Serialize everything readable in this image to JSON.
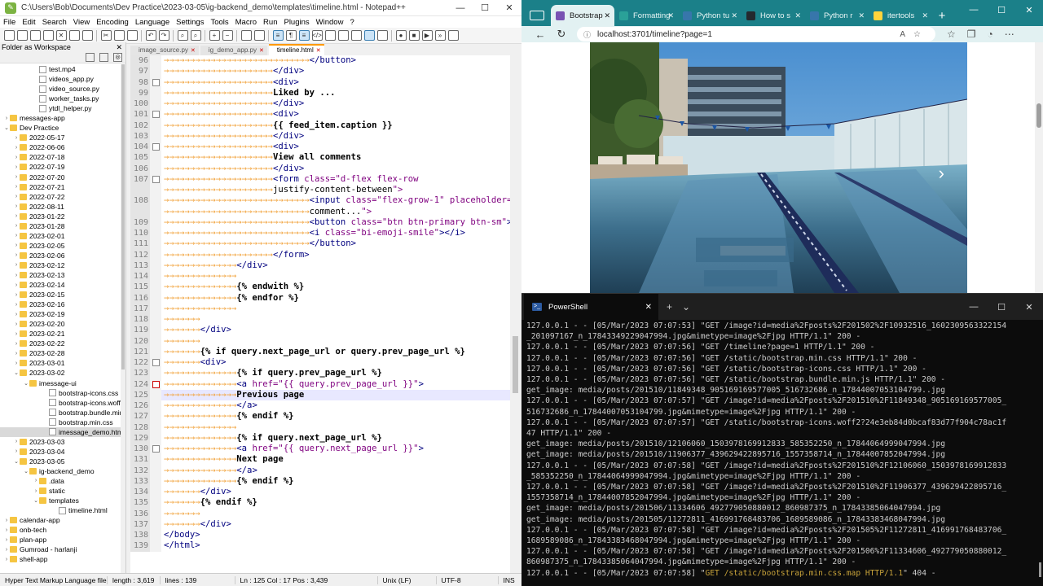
{
  "npp": {
    "title": "C:\\Users\\Bob\\Documents\\Dev Practice\\2023-03-05\\ig-backend_demo\\templates\\timeline.html - Notepad++",
    "menu": [
      "File",
      "Edit",
      "Search",
      "View",
      "Encoding",
      "Language",
      "Settings",
      "Tools",
      "Macro",
      "Run",
      "Plugins",
      "Window",
      "?"
    ],
    "panel_title": "Folder as Workspace",
    "tree": [
      {
        "label": "test.mp4",
        "indent": 3,
        "kind": "file"
      },
      {
        "label": "videos_app.py",
        "indent": 3,
        "kind": "file"
      },
      {
        "label": "video_source.py",
        "indent": 3,
        "kind": "file"
      },
      {
        "label": "worker_tasks.py",
        "indent": 3,
        "kind": "file"
      },
      {
        "label": "ytdl_helper.py",
        "indent": 3,
        "kind": "file"
      },
      {
        "label": "messages-app",
        "indent": 0,
        "kind": "folder",
        "exp": "›"
      },
      {
        "label": "Dev Practice",
        "indent": 0,
        "kind": "folder",
        "exp": "⌄"
      },
      {
        "label": "2022-05-17",
        "indent": 1,
        "kind": "folder",
        "exp": "›"
      },
      {
        "label": "2022-06-06",
        "indent": 1,
        "kind": "folder",
        "exp": "›"
      },
      {
        "label": "2022-07-18",
        "indent": 1,
        "kind": "folder",
        "exp": "›"
      },
      {
        "label": "2022-07-19",
        "indent": 1,
        "kind": "folder",
        "exp": "›"
      },
      {
        "label": "2022-07-20",
        "indent": 1,
        "kind": "folder",
        "exp": "›"
      },
      {
        "label": "2022-07-21",
        "indent": 1,
        "kind": "folder",
        "exp": "›"
      },
      {
        "label": "2022-07-22",
        "indent": 1,
        "kind": "folder",
        "exp": "›"
      },
      {
        "label": "2022-08-11",
        "indent": 1,
        "kind": "folder",
        "exp": "›"
      },
      {
        "label": "2023-01-22",
        "indent": 1,
        "kind": "folder",
        "exp": "›"
      },
      {
        "label": "2023-01-28",
        "indent": 1,
        "kind": "folder",
        "exp": "›"
      },
      {
        "label": "2023-02-01",
        "indent": 1,
        "kind": "folder",
        "exp": "›"
      },
      {
        "label": "2023-02-05",
        "indent": 1,
        "kind": "folder",
        "exp": "›"
      },
      {
        "label": "2023-02-06",
        "indent": 1,
        "kind": "folder",
        "exp": "›"
      },
      {
        "label": "2023-02-12",
        "indent": 1,
        "kind": "folder",
        "exp": "›"
      },
      {
        "label": "2023-02-13",
        "indent": 1,
        "kind": "folder",
        "exp": "›"
      },
      {
        "label": "2023-02-14",
        "indent": 1,
        "kind": "folder",
        "exp": "›"
      },
      {
        "label": "2023-02-15",
        "indent": 1,
        "kind": "folder",
        "exp": "›"
      },
      {
        "label": "2023-02-16",
        "indent": 1,
        "kind": "folder",
        "exp": "›"
      },
      {
        "label": "2023-02-19",
        "indent": 1,
        "kind": "folder",
        "exp": "›"
      },
      {
        "label": "2023-02-20",
        "indent": 1,
        "kind": "folder",
        "exp": "›"
      },
      {
        "label": "2023-02-21",
        "indent": 1,
        "kind": "folder",
        "exp": "›"
      },
      {
        "label": "2023-02-22",
        "indent": 1,
        "kind": "folder",
        "exp": "›"
      },
      {
        "label": "2023-02-28",
        "indent": 1,
        "kind": "folder",
        "exp": "›"
      },
      {
        "label": "2023-03-01",
        "indent": 1,
        "kind": "folder",
        "exp": "›"
      },
      {
        "label": "2023-03-02",
        "indent": 1,
        "kind": "folder",
        "exp": "⌄"
      },
      {
        "label": "imessage-ui",
        "indent": 2,
        "kind": "folder",
        "exp": "⌄"
      },
      {
        "label": "bootstrap-icons.css",
        "indent": 4,
        "kind": "file"
      },
      {
        "label": "bootstrap-icons.woff2",
        "indent": 4,
        "kind": "file"
      },
      {
        "label": "bootstrap.bundle.min.js",
        "indent": 4,
        "kind": "file"
      },
      {
        "label": "bootstrap.min.css",
        "indent": 4,
        "kind": "file"
      },
      {
        "label": "imessage_demo.html",
        "indent": 4,
        "kind": "file",
        "sel": true
      },
      {
        "label": "2023-03-03",
        "indent": 1,
        "kind": "folder",
        "exp": "›"
      },
      {
        "label": "2023-03-04",
        "indent": 1,
        "kind": "folder",
        "exp": "›"
      },
      {
        "label": "2023-03-05",
        "indent": 1,
        "kind": "folder",
        "exp": "⌄"
      },
      {
        "label": "ig-backend_demo",
        "indent": 2,
        "kind": "folder",
        "exp": "⌄"
      },
      {
        "label": ".data",
        "indent": 3,
        "kind": "folder",
        "exp": "›"
      },
      {
        "label": "static",
        "indent": 3,
        "kind": "folder",
        "exp": "›"
      },
      {
        "label": "templates",
        "indent": 3,
        "kind": "folder",
        "exp": "⌄"
      },
      {
        "label": "timeline.html",
        "indent": 5,
        "kind": "file"
      },
      {
        "label": "calendar-app",
        "indent": 0,
        "kind": "folder",
        "exp": "›"
      },
      {
        "label": "onb-tech",
        "indent": 0,
        "kind": "folder",
        "exp": "›"
      },
      {
        "label": "plan-app",
        "indent": 0,
        "kind": "folder",
        "exp": "›"
      },
      {
        "label": "Gumroad - harlanji",
        "indent": 0,
        "kind": "folder",
        "exp": "›"
      },
      {
        "label": "shell-app",
        "indent": 0,
        "kind": "folder",
        "exp": "›"
      }
    ],
    "tabs": [
      {
        "label": "image_source.py",
        "active": false
      },
      {
        "label": "ig_demo_app.py",
        "active": false
      },
      {
        "label": "timeline.html",
        "active": true
      }
    ],
    "lines": [
      {
        "n": "96",
        "d": 4,
        "c": "</button>",
        "f": ""
      },
      {
        "n": "97",
        "d": 3,
        "c": "</div>",
        "f": ""
      },
      {
        "n": "98",
        "d": 3,
        "c": "<div>",
        "f": "box"
      },
      {
        "n": "99",
        "d": 3,
        "c": "Liked by ...",
        "f": "",
        "txt": true
      },
      {
        "n": "100",
        "d": 3,
        "c": "</div>",
        "f": ""
      },
      {
        "n": "101",
        "d": 3,
        "c": "<div>",
        "f": "box"
      },
      {
        "n": "102",
        "d": 3,
        "c": "{{ feed_item.caption }}",
        "f": "",
        "txt": true
      },
      {
        "n": "103",
        "d": 3,
        "c": "</div>",
        "f": ""
      },
      {
        "n": "104",
        "d": 3,
        "c": "<div>",
        "f": "box"
      },
      {
        "n": "105",
        "d": 3,
        "c": "View all comments",
        "f": "",
        "txt": true
      },
      {
        "n": "106",
        "d": 3,
        "c": "</div>",
        "f": ""
      },
      {
        "n": "107",
        "d": 3,
        "c": "<form class=\"d-flex flex-row",
        "f": "box"
      },
      {
        "n": "",
        "d": 3,
        "c": "justify-content-between\">",
        "f": ""
      },
      {
        "n": "108",
        "d": 4,
        "c": "<input class=\"flex-grow-1\" placeholder=\"Add a",
        "f": ""
      },
      {
        "n": "",
        "d": 4,
        "c": "comment...\">",
        "f": ""
      },
      {
        "n": "109",
        "d": 4,
        "c": "<button class=\"btn btn-primary btn-sm\">",
        "f": ""
      },
      {
        "n": "110",
        "d": 4,
        "c": "<i class=\"bi-emoji-smile\"></i>",
        "f": ""
      },
      {
        "n": "111",
        "d": 4,
        "c": "</button>",
        "f": ""
      },
      {
        "n": "112",
        "d": 3,
        "c": "</form>",
        "f": ""
      },
      {
        "n": "113",
        "d": 2,
        "c": "</div>",
        "f": ""
      },
      {
        "n": "114",
        "d": 2,
        "c": "",
        "f": ""
      },
      {
        "n": "115",
        "d": 2,
        "c": "{% endwith %}",
        "f": "",
        "txt": true
      },
      {
        "n": "116",
        "d": 2,
        "c": "{% endfor %}",
        "f": "",
        "txt": true
      },
      {
        "n": "117",
        "d": 2,
        "c": "",
        "f": ""
      },
      {
        "n": "118",
        "d": 1,
        "c": "",
        "f": ""
      },
      {
        "n": "119",
        "d": 1,
        "c": "</div>",
        "f": ""
      },
      {
        "n": "120",
        "d": 1,
        "c": "",
        "f": ""
      },
      {
        "n": "121",
        "d": 1,
        "c": "{% if query.next_page_url or query.prev_page_url %}",
        "f": "",
        "txt": true
      },
      {
        "n": "122",
        "d": 1,
        "c": "<div>",
        "f": "box"
      },
      {
        "n": "123",
        "d": 2,
        "c": "{% if query.prev_page_url %}",
        "f": "",
        "txt": true
      },
      {
        "n": "124",
        "d": 2,
        "c": "<a href=\"{{ query.prev_page_url }}\">",
        "f": "boxred"
      },
      {
        "n": "125",
        "d": 2,
        "c": "Previous page",
        "f": "",
        "txt": true,
        "cur": true
      },
      {
        "n": "126",
        "d": 2,
        "c": "</a>",
        "f": ""
      },
      {
        "n": "127",
        "d": 2,
        "c": "{% endif %}",
        "f": "",
        "txt": true
      },
      {
        "n": "128",
        "d": 2,
        "c": "",
        "f": ""
      },
      {
        "n": "129",
        "d": 2,
        "c": "{% if query.next_page_url %}",
        "f": "",
        "txt": true
      },
      {
        "n": "130",
        "d": 2,
        "c": "<a href=\"{{ query.next_page_url }}\">",
        "f": "box"
      },
      {
        "n": "131",
        "d": 2,
        "c": "Next page",
        "f": "",
        "txt": true
      },
      {
        "n": "132",
        "d": 2,
        "c": "</a>",
        "f": ""
      },
      {
        "n": "133",
        "d": 2,
        "c": "{% endif %}",
        "f": "",
        "txt": true
      },
      {
        "n": "134",
        "d": 1,
        "c": "</div>",
        "f": ""
      },
      {
        "n": "135",
        "d": 1,
        "c": "{% endif %}",
        "f": "",
        "txt": true
      },
      {
        "n": "136",
        "d": 1,
        "c": "",
        "f": ""
      },
      {
        "n": "137",
        "d": 1,
        "c": "</div>",
        "f": ""
      },
      {
        "n": "138",
        "d": 0,
        "c": "</body>",
        "f": ""
      },
      {
        "n": "139",
        "d": 0,
        "c": "</html>",
        "f": ""
      }
    ],
    "status": {
      "lang": "Hyper Text Markup Language file",
      "length": "length : 3,619",
      "lines": "lines : 139",
      "pos": "Ln : 125    Col : 17    Pos : 3,439",
      "eol": "Unix (LF)",
      "enc": "UTF-8",
      "ins": "INS"
    }
  },
  "edge": {
    "tabs": [
      {
        "label": "Bootstrap",
        "active": true,
        "color": "#7952b3"
      },
      {
        "label": "Formatting",
        "active": false,
        "color": "#2aa198"
      },
      {
        "label": "Python tu",
        "active": false,
        "color": "#3776ab"
      },
      {
        "label": "How to s",
        "active": false,
        "color": "#24292e"
      },
      {
        "label": "Python r",
        "active": false,
        "color": "#3776ab"
      },
      {
        "label": "itertools",
        "active": false,
        "color": "#ffd43b"
      }
    ],
    "url": "localhost:3701/timeline?page=1"
  },
  "ps": {
    "tab_title": "PowerShell",
    "lines": [
      {
        "t": "127.0.0.1 - - [05/Mar/2023 07:07:53] \"GET /image?id=media%2Fposts%2F201502%2F10932516_1602309563322154"
      },
      {
        "t": "_201097167_n_17843349229047994.jpg&mimetype=image%2Fjpg HTTP/1.1\" 200 -"
      },
      {
        "t": "127.0.0.1 - - [05/Mar/2023 07:07:56] \"GET /timeline?page=1 HTTP/1.1\" 200 -"
      },
      {
        "t": "127.0.0.1 - - [05/Mar/2023 07:07:56] \"GET /static/bootstrap.min.css HTTP/1.1\" 200 -"
      },
      {
        "t": "127.0.0.1 - - [05/Mar/2023 07:07:56] \"GET /static/bootstrap-icons.css HTTP/1.1\" 200 -"
      },
      {
        "t": "127.0.0.1 - - [05/Mar/2023 07:07:56] \"GET /static/bootstrap.bundle.min.js HTTP/1.1\" 200 -"
      },
      {
        "t": "get_image: media/posts/201510/11849348_905169169577005_516732686_n_17844007053104799..jpg"
      },
      {
        "t": "127.0.0.1 - - [05/Mar/2023 07:07:57] \"GET /image?id=media%2Fposts%2F201510%2F11849348_905169169577005_"
      },
      {
        "t": "516732686_n_17844007053104799.jpg&mimetype=image%2Fjpg HTTP/1.1\" 200 -"
      },
      {
        "t": "127.0.0.1 - - [05/Mar/2023 07:07:57] \"GET /static/bootstrap-icons.woff2?24e3eb84d0bcaf83d77f904c78ac1f"
      },
      {
        "t": "47 HTTP/1.1\" 200 -"
      },
      {
        "t": "get_image: media/posts/201510/12106060_1503978169912833_585352250_n_17844064999047994.jpg"
      },
      {
        "t": "get_image: media/posts/201510/11906377_439629422895716_1557358714_n_17844007852047994.jpg"
      },
      {
        "t": "127.0.0.1 - - [05/Mar/2023 07:07:58] \"GET /image?id=media%2Fposts%2F201510%2F12106060_1503978169912833"
      },
      {
        "t": "_585352250_n_17844064999047994.jpg&mimetype=image%2Fjpg HTTP/1.1\" 200 -"
      },
      {
        "t": "127.0.0.1 - - [05/Mar/2023 07:07:58] \"GET /image?id=media%2Fposts%2F201510%2F11906377_439629422895716_"
      },
      {
        "t": "1557358714_n_17844007852047994.jpg&mimetype=image%2Fjpg HTTP/1.1\" 200 -"
      },
      {
        "t": "get_image: media/posts/201506/11334606_492779050880012_860987375_n_17843385064047994.jpg"
      },
      {
        "t": "get_image: media/posts/201505/11272811_416991768483706_1689589086_n_17843383468047994.jpg"
      },
      {
        "t": "127.0.0.1 - - [05/Mar/2023 07:07:58] \"GET /image?id=media%2Fposts%2F201505%2F11272811_416991768483706_"
      },
      {
        "t": "1689589086_n_17843383468047994.jpg&mimetype=image%2Fjpg HTTP/1.1\" 200 -"
      },
      {
        "t": "127.0.0.1 - - [05/Mar/2023 07:07:58] \"GET /image?id=media%2Fposts%2F201506%2F11334606_492779050880012_"
      },
      {
        "t": "860987375_n_17843385064047994.jpg&mimetype=image%2Fjpg HTTP/1.1\" 200 -"
      },
      {
        "t": "127.0.0.1 - - [05/Mar/2023 07:07:58] \"",
        "y": "GET /static/bootstrap.min.css.map HTTP/1.1",
        "e": "\" 404 -"
      }
    ]
  }
}
